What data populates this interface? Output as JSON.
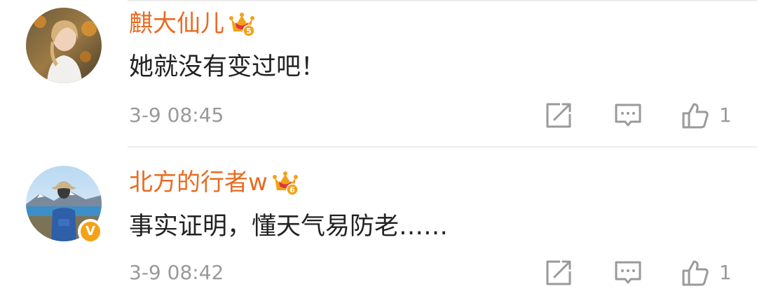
{
  "comments": [
    {
      "username": "麒大仙儿",
      "text": "她就没有变过吧！",
      "time": "3-9 08:45",
      "like_count": "1",
      "vip_level": "5",
      "verified": false
    },
    {
      "username": "北方的行者w",
      "text": "事实证明，懂天气易防老……",
      "time": "3-9 08:42",
      "like_count": "1",
      "vip_level": "6",
      "verified": true,
      "verified_mark": "V"
    }
  ],
  "icons": {
    "repost": "repost-icon",
    "reply": "comment-icon",
    "like": "thumbs-up-icon",
    "vip": "crown-icon"
  },
  "colors": {
    "username": "#e86b22",
    "text": "#222222",
    "meta": "#999999",
    "verified_badge": "#f3a218",
    "crown": "#f3a218",
    "divider": "#ececec"
  }
}
